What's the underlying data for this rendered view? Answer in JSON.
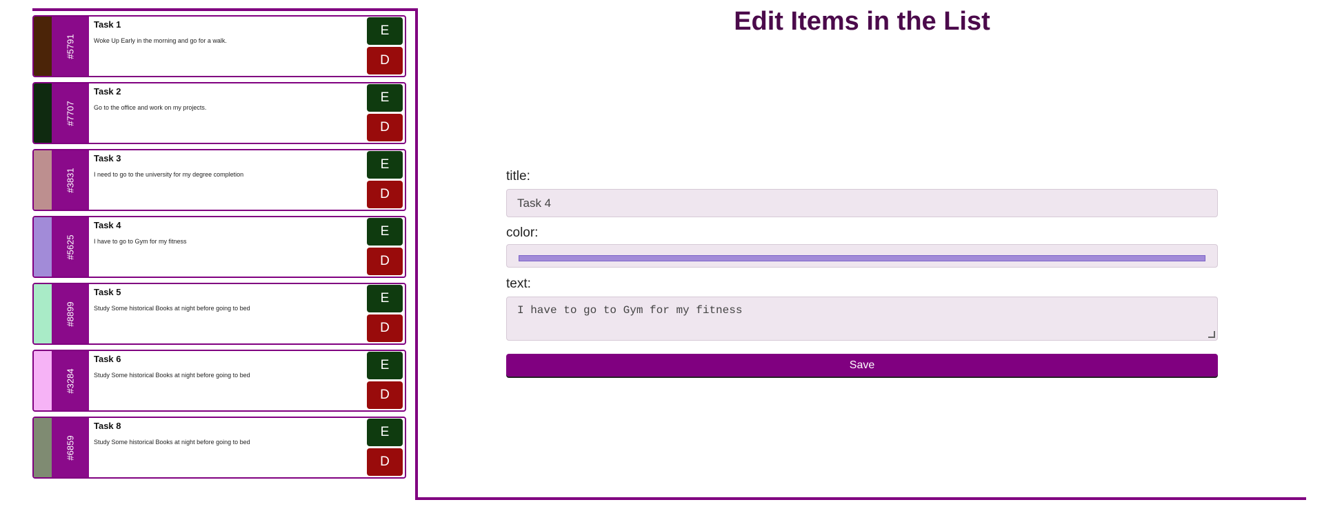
{
  "form": {
    "heading": "Edit Items in the List",
    "title_label": "title:",
    "title_value": "Task 4",
    "color_label": "color:",
    "color_value": "#a28bd8",
    "text_label": "text:",
    "text_value": "I have to go to Gym for my fitness",
    "save_label": "Save"
  },
  "tasks": [
    {
      "id": "#5791",
      "title": "Task 1",
      "text": "Woke Up Early in the morning and go for a walk.",
      "color": "#4b2408",
      "edit": "E",
      "delete": "D"
    },
    {
      "id": "#7707",
      "title": "Task 2",
      "text": "Go to the office and work on my projects.",
      "color": "#0f2a10",
      "edit": "E",
      "delete": "D"
    },
    {
      "id": "#3831",
      "title": "Task 3",
      "text": "I need to go to the university for my degree completion",
      "color": "#bd8f8f",
      "edit": "E",
      "delete": "D"
    },
    {
      "id": "#5625",
      "title": "Task 4",
      "text": "I have to go to Gym for my fitness",
      "color": "#a28bd8",
      "edit": "E",
      "delete": "D"
    },
    {
      "id": "#8899",
      "title": "Task 5",
      "text": "Study Some historical Books at night before going to bed",
      "color": "#a9ebc7",
      "edit": "E",
      "delete": "D"
    },
    {
      "id": "#3284",
      "title": "Task 6",
      "text": "Study Some historical Books at night before going to bed",
      "color": "#f6b3f6",
      "edit": "E",
      "delete": "D"
    },
    {
      "id": "#6859",
      "title": "Task 8",
      "text": "Study Some historical Books at night before going to bed",
      "color": "#7f8b72",
      "edit": "E",
      "delete": "D"
    }
  ]
}
